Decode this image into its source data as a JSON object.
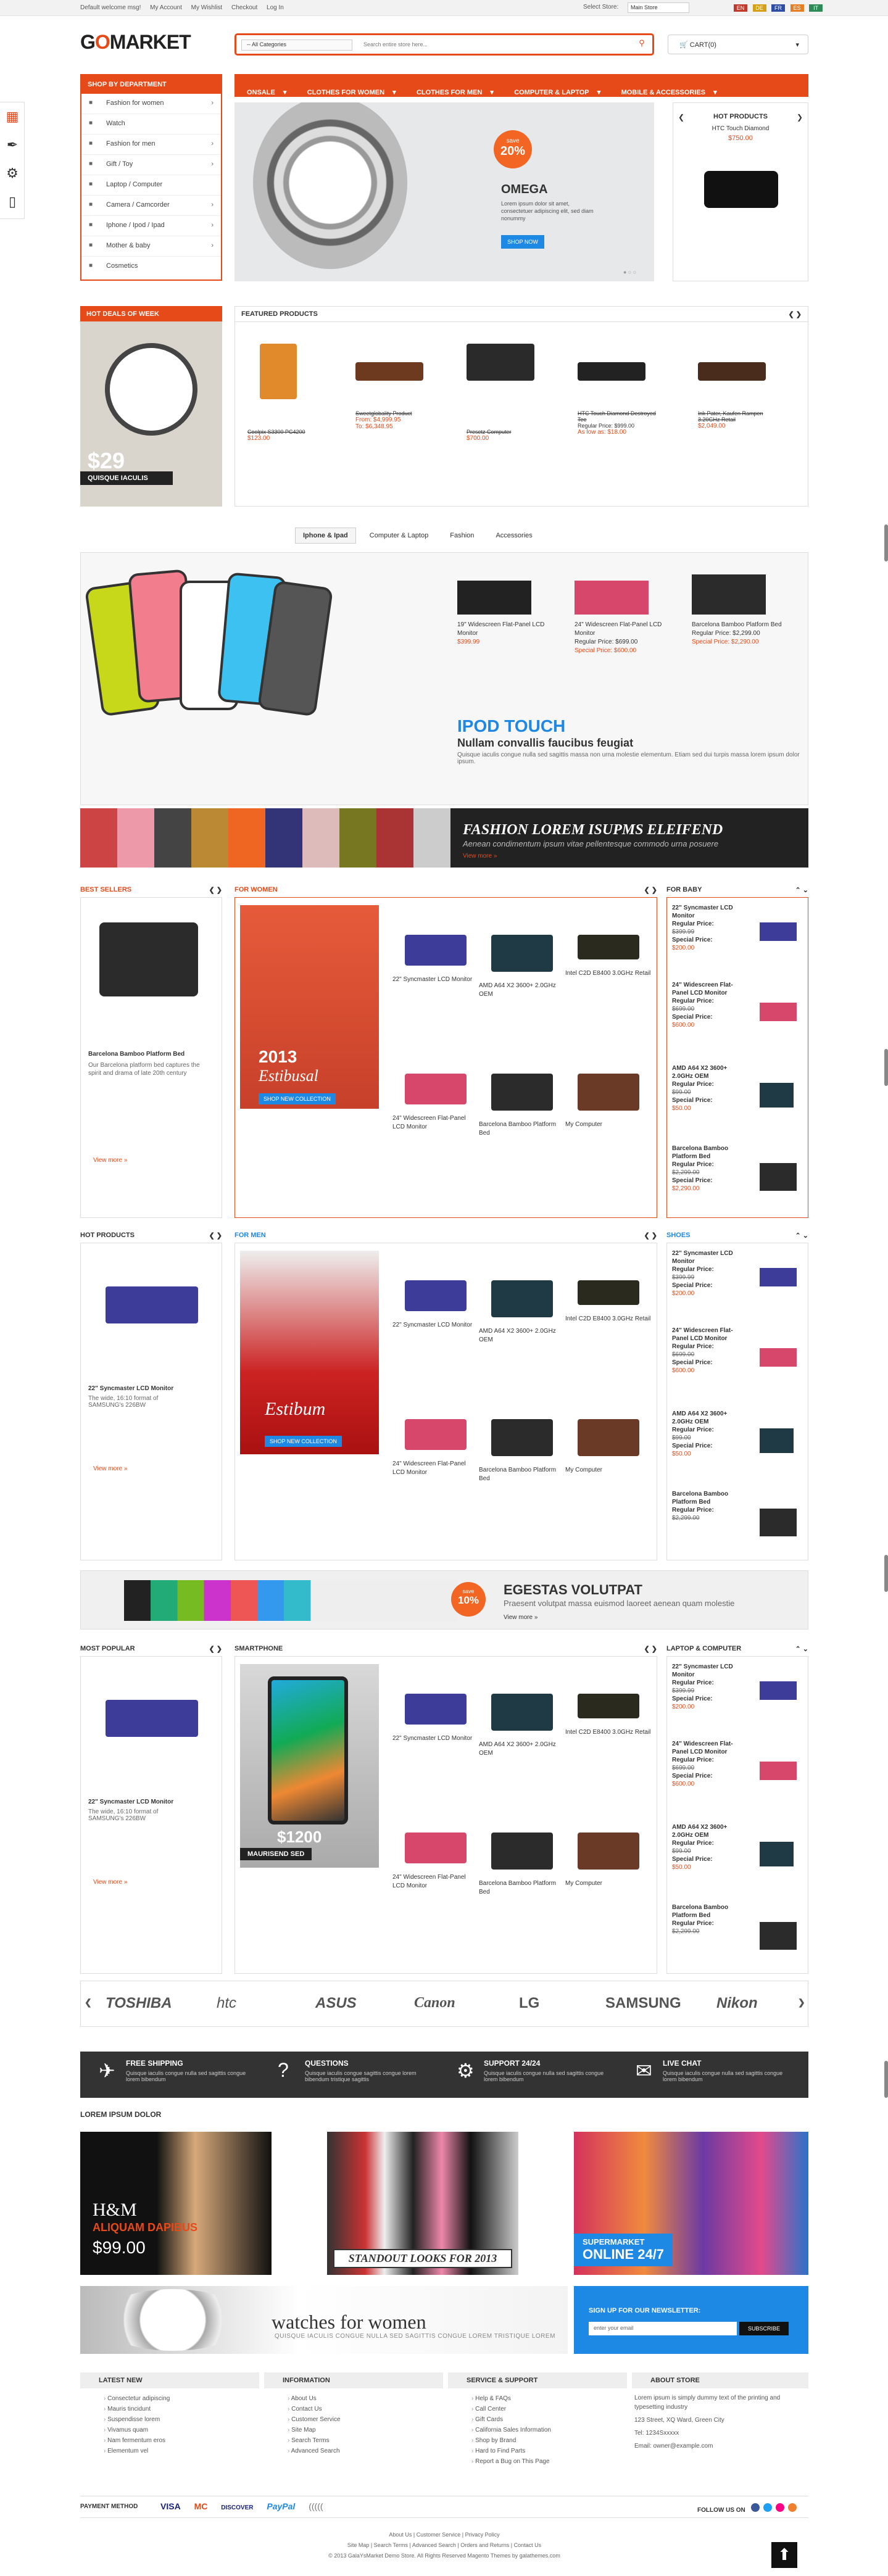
{
  "topbar": {
    "links": [
      "Default welcome msg!",
      "My Account",
      "My Wishlist",
      "Checkout",
      "Log In"
    ],
    "store_label": "Select Store:",
    "store_value": "Main Store",
    "flags": [
      "EN",
      "DE",
      "FR",
      "ES",
      "IT"
    ]
  },
  "logo": {
    "pre": "G",
    "mid": "O",
    "post": "MARKET"
  },
  "search": {
    "category": "-- All Categories",
    "placeholder": "Search entire store here...",
    "icon": "search-icon"
  },
  "cart": {
    "label": "CART(0)"
  },
  "sidetools_icons": [
    "palette-icon",
    "brush-icon",
    "gear-icon",
    "mobile-icon"
  ],
  "departments": {
    "title": "SHOP BY DEPARTMENT",
    "items": [
      "Fashion for women",
      "Watch",
      "Fashion for men",
      "Gift / Toy",
      "Laptop / Computer",
      "Camera / Camcorder",
      "Iphone / Ipod / Ipad",
      "Mother & baby",
      "Cosmetics"
    ]
  },
  "nav": [
    "ONSALE",
    "CLOTHES FOR WOMEN",
    "CLOTHES FOR MEN",
    "COMPUTER & LAPTOP",
    "MOBILE & ACCESSORIES"
  ],
  "hero": {
    "save": "save",
    "percent": "20%",
    "title": "OMEGA",
    "desc": "Lorem ipsum dolor sit amet, consectetuer adipiscing elit, sed diam nonummy",
    "button": "SHOP NOW"
  },
  "hot_products": {
    "title": "HOT PRODUCTS",
    "name": "HTC Touch Diamond",
    "price": "$750.00"
  },
  "deal": {
    "title": "HOT DEALS OF WEEK",
    "price": "$29",
    "label": "QUISQUE IACULIS"
  },
  "featured": {
    "title": "FEATURED PRODUCTS",
    "products": [
      {
        "name": "Coolpix S3300 PC4200",
        "price": "$123.00",
        "color": "#e08a2b"
      },
      {
        "name": "Sweetglobality Product",
        "price": "From: $4,999.95",
        "price2": "To: $6,348.95",
        "color": "#6d3a1f"
      },
      {
        "name": "Presetz Computer",
        "price": "$700.00",
        "color": "#c0392b"
      },
      {
        "name": "HTC Touch Diamond Destroyed Tee",
        "price": "Regular Price: $999.00",
        "price2": "As low as: $18.00",
        "color": "#222"
      },
      {
        "name": "Ink Pater, Kaufen Rampen 3.20GHz Retail",
        "price": "$2,049.00",
        "color": "#4a2c1d"
      }
    ]
  },
  "tabs": [
    "Iphone & Ipad",
    "Computer & Laptop",
    "Fashion",
    "Accessories"
  ],
  "ipod": {
    "items": [
      {
        "name": "19\" Widescreen Flat-Panel LCD Monitor",
        "price": "$399.99"
      },
      {
        "name": "24\" Widescreen Flat-Panel LCD Monitor",
        "regular": "Regular Price: $699.00",
        "special": "Special Price: $600.00"
      },
      {
        "name": "Barcelona Bamboo Platform Bed",
        "regular": "Regular Price: $2,299.00",
        "special": "Special Price: $2,290.00"
      }
    ],
    "title": "IPOD TOUCH",
    "subtitle": "Nullam convallis faucibus feugiat",
    "desc": "Quisque iaculis congue nulla sed sagittis massa non urna molestie elementum. Etiam sed dui turpis massa lorem ipsum dolor ipsum."
  },
  "fashion_banner": {
    "title": "FASHION LOREM ISUPMS ELEIFEND",
    "sub": "Aenean condimentum ipsum vitae pellentesque commodo urna posuere",
    "more": "View more »"
  },
  "best_sellers": {
    "title": "BEST SELLERS",
    "name": "Barcelona Bamboo Platform Bed",
    "desc": "Our Barcelona platform bed captures the spirit and drama of late 20th century",
    "more": "View more »"
  },
  "for_women": {
    "title": "FOR WOMEN",
    "year": "2013",
    "script": "Estibusal",
    "cta": "SHOP NEW COLLECTION"
  },
  "grid_products": [
    "22\" Syncmaster LCD Monitor",
    "AMD A64 X2 3600+ 2.0GHz OEM",
    "Intel C2D E8400 3.0GHz Retail",
    "24\" Widescreen Flat-Panel LCD Monitor",
    "Barcelona Bamboo Platform Bed",
    "My Computer"
  ],
  "for_baby": {
    "title": "FOR BABY",
    "items": [
      {
        "name": "22\" Syncmaster LCD Monitor",
        "regular": "$399.99",
        "special": "$200.00"
      },
      {
        "name": "24\" Widescreen Flat-Panel LCD Monitor",
        "regular": "$699.00",
        "special": "$600.00"
      },
      {
        "name": "AMD A64 X2 3600+ 2.0GHz OEM",
        "regular": "$99.00",
        "special": "$50.00"
      },
      {
        "name": "Barcelona Bamboo Platform Bed",
        "regular": "$2,299.00",
        "special": "$2,290.00"
      }
    ],
    "reg_label": "Regular Price:",
    "spec_label": "Special Price:"
  },
  "hot_products2": {
    "title": "HOT PRODUCTS",
    "name": "22\" Syncmaster LCD Monitor",
    "desc": "The wide, 16:10 format of SAMSUNG's 226BW",
    "more": "View more »"
  },
  "for_men": {
    "title": "FOR MEN",
    "script": "Estibum",
    "cta": "SHOP NEW COLLECTION"
  },
  "shoes": {
    "title": "SHOES"
  },
  "egestas": {
    "save": "save",
    "percent": "10%",
    "title": "EGESTAS VOLUTPAT",
    "sub": "Praesent volutpat massa euismod laoreet aenean quam molestie",
    "more": "View more »"
  },
  "most_popular": {
    "title": "MOST POPULAR"
  },
  "smartphone": {
    "title": "SMARTPHONE",
    "price": "$1200",
    "label": "MAURISEND SED"
  },
  "laptop": {
    "title": "LAPTOP & COMPUTER"
  },
  "brands": [
    "TOSHIBA",
    "htc",
    "ASUS",
    "Canon",
    "LG",
    "SAMSUNG",
    "Nikon"
  ],
  "services": [
    {
      "icon": "plane-icon",
      "title": "FREE SHIPPING",
      "text": "Quisque iaculis congue nulla sed sagittis congue lorem bibendum"
    },
    {
      "icon": "question-icon",
      "title": "QUESTIONS",
      "text": "Quisque iaculis congue sagittis congue lorem bibendum tristique sagittis"
    },
    {
      "icon": "support-icon",
      "title": "SUPPORT 24/24",
      "text": "Quisque iaculis congue nulla sed sagittis congue lorem bibendum"
    },
    {
      "icon": "chat-icon",
      "title": "LIVE CHAT",
      "text": "Quisque iaculis congue nulla sed sagittis congue lorem bibendum"
    }
  ],
  "lorem": {
    "title": "LOREM IPSUM DOLOR"
  },
  "promos": [
    {
      "brand": "H&M",
      "line": "ALIQUAM DAPIBUS",
      "price": "$99.00"
    },
    {
      "line": "STANDOUT LOOKS FOR 2013"
    },
    {
      "line": "SUPERMARKET",
      "line2": "ONLINE 24/7"
    }
  ],
  "watches": {
    "title": "watches for women",
    "sub": "QUISQUE IACULIS CONGUE NULLA SED SAGITTIS CONGUE LOREM TRISTIQUE LOREM"
  },
  "newsletter": {
    "title": "SIGN UP FOR OUR NEWSLETTER:",
    "placeholder": "enter your email",
    "button": "SUBSCRIBE"
  },
  "footer": {
    "cols": [
      {
        "title": "LATEST NEW",
        "items": [
          "Consectetur adipiscing",
          "Mauris tincidunt",
          "Suspendisse lorem",
          "Vivamus quam",
          "Nam fermentum eros",
          "Elementum vel"
        ]
      },
      {
        "title": "INFORMATION",
        "items": [
          "About Us",
          "Contact Us",
          "Customer Service",
          "Site Map",
          "Search Terms",
          "Advanced Search"
        ]
      },
      {
        "title": "SERVICE & SUPPORT",
        "items": [
          "Help & FAQs",
          "Call Center",
          "Gift Cards",
          "California Sales Information",
          "Shop by Brand",
          "Hard to Find Parts",
          "Report a Bug on This Page"
        ]
      },
      {
        "title": "ABOUT STORE",
        "text": "Lorem ipsum is simply dummy text of the printing and typesetting industry",
        "address": "123 Street, XQ Ward, Green City",
        "tel": "Tel: 1234Sxxxxx",
        "email": "Email: owner@example.com"
      }
    ]
  },
  "payment": {
    "label": "PAYMENT METHOD",
    "methods": [
      "VISA",
      "MC",
      "DISCOVER",
      "PayPal",
      "((((("
    ],
    "follow": "FOLLOW US ON"
  },
  "bottom": {
    "row1": "About Us | Customer Service | Privacy Policy",
    "row2": "Site Map | Search Terms | Advanced Search | Orders and Returns | Contact Us",
    "row3": "© 2013 GalaYsMarket Demo Store. All Rights Reserved Magento Themes by galathemes.com"
  },
  "colors": {
    "accent": "#e64a19",
    "blue": "#1e88e5"
  }
}
